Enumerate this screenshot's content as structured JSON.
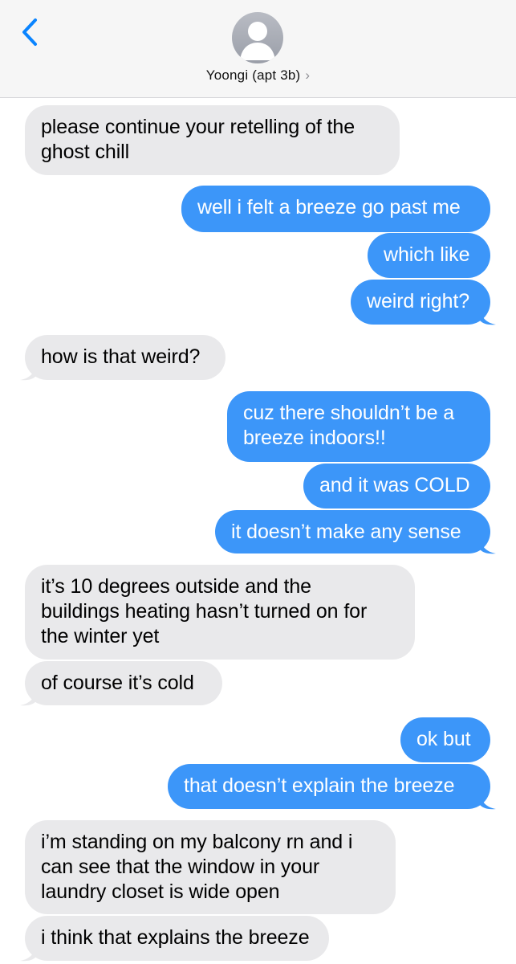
{
  "header": {
    "contact_name": "Yoongi (apt 3b)",
    "chevron": "›",
    "back_icon": "chevron-left-icon",
    "avatar_icon": "person-silhouette-icon"
  },
  "colors": {
    "incoming_bubble": "#e9e9eb",
    "outgoing_bubble": "#3c96f9",
    "accent": "#0a84ff"
  },
  "messages": [
    {
      "from": "them",
      "lines": [
        "please continue your retelling of the",
        "ghost chill"
      ]
    },
    {
      "from": "me",
      "lines": [
        "well i felt a breeze go past me"
      ]
    },
    {
      "from": "me",
      "lines": [
        "which like"
      ]
    },
    {
      "from": "me",
      "lines": [
        "weird right?"
      ]
    },
    {
      "from": "them",
      "lines": [
        "how is that weird?"
      ]
    },
    {
      "from": "me",
      "lines": [
        "cuz there shouldn’t be a",
        "breeze indoors!!"
      ]
    },
    {
      "from": "me",
      "lines": [
        "and it was COLD"
      ]
    },
    {
      "from": "me",
      "lines": [
        "it doesn’t make any sense"
      ]
    },
    {
      "from": "them",
      "lines": [
        "it’s 10 degrees outside and the",
        "buildings heating hasn’t turned on for",
        "the winter yet"
      ]
    },
    {
      "from": "them",
      "lines": [
        "of course it’s cold"
      ]
    },
    {
      "from": "me",
      "lines": [
        "ok but"
      ]
    },
    {
      "from": "me",
      "lines": [
        "that doesn’t explain the breeze"
      ]
    },
    {
      "from": "them",
      "lines": [
        "i’m standing on my balcony rn and i",
        "can see that the window in your",
        "laundry closet is wide open"
      ]
    },
    {
      "from": "them",
      "lines": [
        "i think that explains the breeze"
      ]
    }
  ]
}
